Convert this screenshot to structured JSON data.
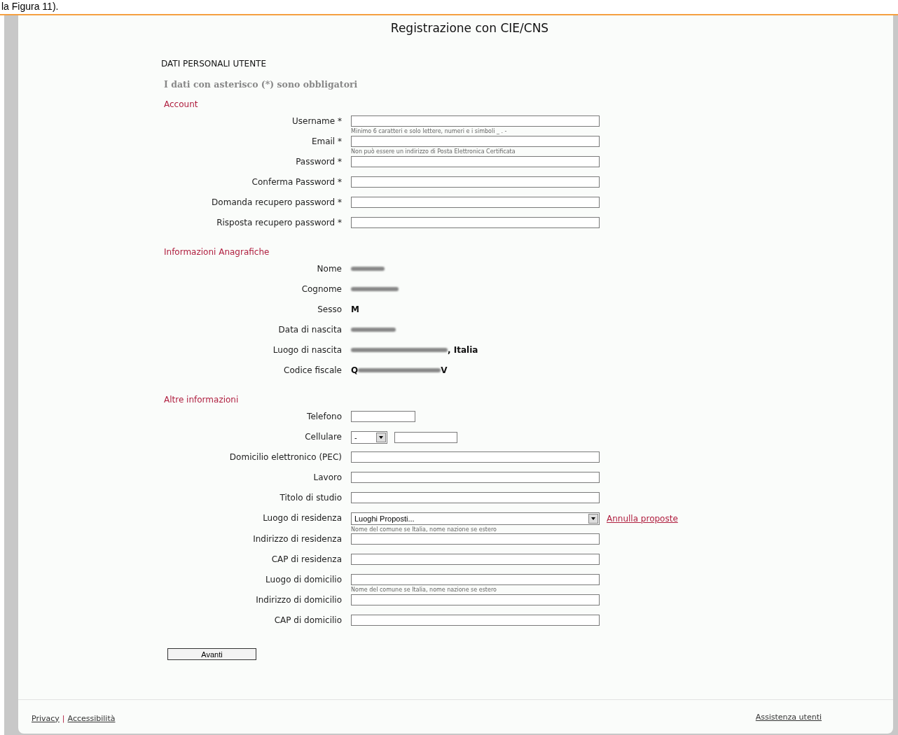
{
  "caption": "la Figura 11).",
  "page_title": "Registrazione con CIE/CNS",
  "heading": "DATI PERSONALI UTENTE",
  "required_note": "I dati con asterisco (*) sono obbligatori",
  "sections": [
    {
      "title": "Account",
      "rows": [
        {
          "kind": "input",
          "label": "Username *",
          "hint": "Minimo 6 caratteri e solo lettere, numeri e i simboli _ . -"
        },
        {
          "kind": "input",
          "label": "Email *",
          "hint": "Non può essere un indirizzo di Posta Elettronica Certificata"
        },
        {
          "kind": "input",
          "label": "Password *"
        },
        {
          "kind": "input",
          "label": "Conferma Password *"
        },
        {
          "kind": "input",
          "label": "Domanda recupero password *"
        },
        {
          "kind": "input",
          "label": "Risposta recupero password *"
        }
      ]
    },
    {
      "title": "Informazioni Anagrafiche",
      "rows": [
        {
          "kind": "static",
          "label": "Nome",
          "redacted": true
        },
        {
          "kind": "static",
          "label": "Cognome",
          "redacted": true
        },
        {
          "kind": "static",
          "label": "Sesso",
          "value": "M",
          "redacted": false
        },
        {
          "kind": "static",
          "label": "Data di nascita",
          "redacted": true
        },
        {
          "kind": "static",
          "label": "Luogo di nascita",
          "redacted": true,
          "suffix": ", Italia"
        },
        {
          "kind": "static",
          "label": "Codice fiscale",
          "value": "Q",
          "redacted": true,
          "suffix": "V"
        }
      ]
    },
    {
      "title": "Altre informazioni",
      "rows": [
        {
          "kind": "short",
          "label": "Telefono"
        },
        {
          "kind": "phone",
          "label": "Cellulare",
          "prefix_value": "-"
        },
        {
          "kind": "input",
          "label": "Domicilio elettronico (PEC)"
        },
        {
          "kind": "input",
          "label": "Lavoro"
        },
        {
          "kind": "input",
          "label": "Titolo di studio"
        },
        {
          "kind": "select",
          "label": "Luogo di residenza",
          "value": "Luoghi Proposti...",
          "link": "Annulla proposte",
          "hint": "Nome del comune se Italia, nome nazione se estero"
        },
        {
          "kind": "input",
          "label": "Indirizzo di residenza"
        },
        {
          "kind": "input",
          "label": "CAP di residenza"
        },
        {
          "kind": "input",
          "label": "Luogo di domicilio",
          "hint": "Nome del comune se Italia, nome nazione se estero"
        },
        {
          "kind": "input",
          "label": "Indirizzo di domicilio"
        },
        {
          "kind": "input",
          "label": "CAP di domicilio"
        }
      ]
    }
  ],
  "submit": "Avanti",
  "footer": {
    "left_links": [
      "Privacy",
      "Accessibilità"
    ],
    "separator": "|",
    "right_link": "Assistenza utenti"
  }
}
